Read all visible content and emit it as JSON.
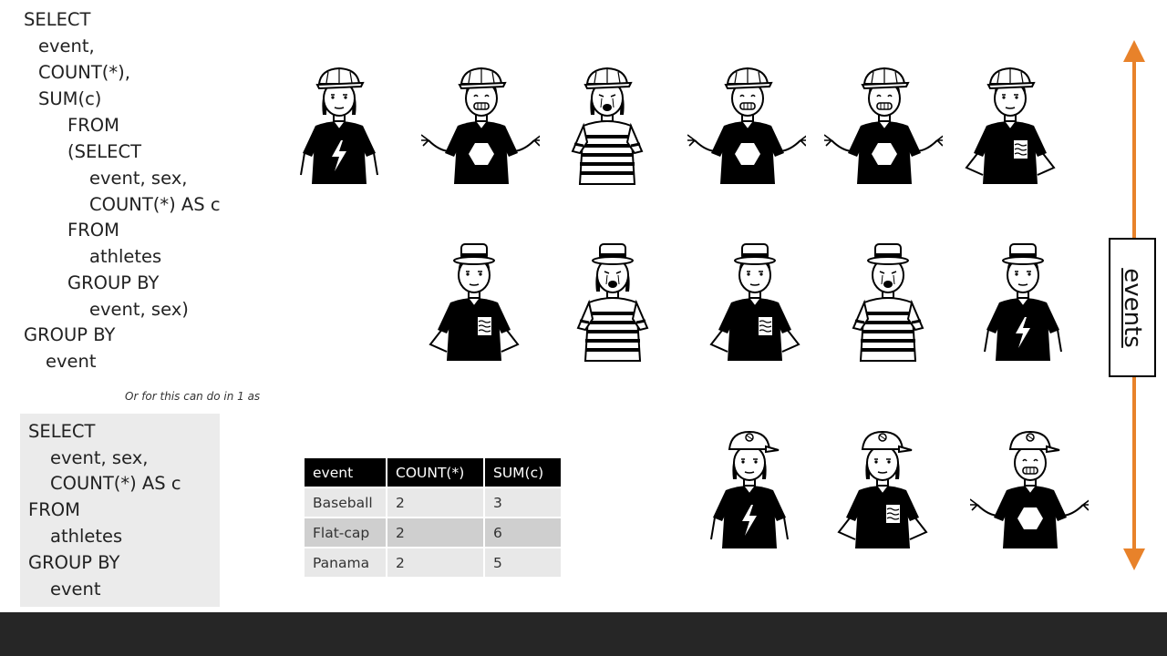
{
  "query_main": {
    "lines": [
      "SELECT",
      "event,",
      "COUNT(*),",
      "SUM(c)",
      "FROM",
      "(SELECT",
      "event, sex,",
      "COUNT(*) AS c",
      "FROM",
      "athletes",
      "GROUP BY",
      "event, sex)",
      "GROUP BY",
      "event"
    ]
  },
  "note": "Or for this  can  do in 1 as",
  "query_alt": {
    "lines": [
      "SELECT",
      "event, sex,",
      "COUNT(*) AS c",
      "FROM",
      "athletes",
      "GROUP BY",
      "event"
    ]
  },
  "result_table": {
    "headers": [
      "event",
      "COUNT(*)",
      "SUM(c)"
    ],
    "rows": [
      [
        "Baseball",
        "2",
        "3"
      ],
      [
        "Flat-cap",
        "2",
        "6"
      ],
      [
        "Panama",
        "2",
        "5"
      ]
    ]
  },
  "side_label": "events",
  "colors": {
    "arrow": "#e8822a",
    "header_bg": "#000000",
    "row_odd": "#cfcfcf",
    "row_even": "#e8e8e8",
    "code_box_bg": "#ebebeb",
    "footer": "#262626"
  }
}
